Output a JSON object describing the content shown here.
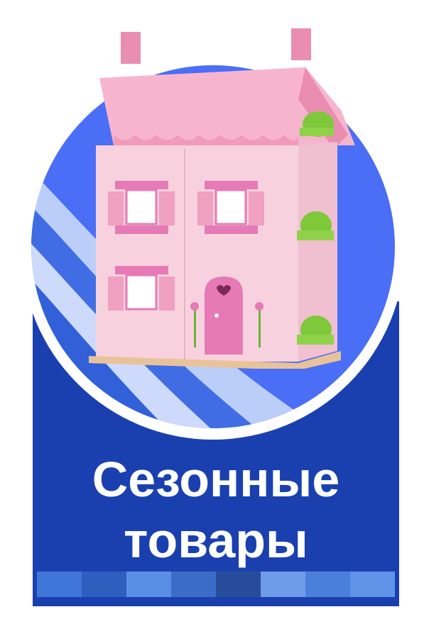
{
  "banner": {
    "title_line1": "Сезонные",
    "title_line2": "товары"
  },
  "image": {
    "subject": "pink-wooden-dollhouse"
  },
  "colors": {
    "card": "#1a40b0",
    "circle": "#4a6ef6",
    "text": "#ffffff",
    "house_wall": "#f7d2de",
    "roof": "#f29ab8",
    "door": "#e57ab6",
    "plant": "#7ec83a"
  },
  "strip_colors": [
    "#3f76d8",
    "#2c5fbe",
    "#5a8fe6",
    "#3a6cc8",
    "#274c9a",
    "#6f9ce8",
    "#4a80dc",
    "#5e93e8"
  ]
}
